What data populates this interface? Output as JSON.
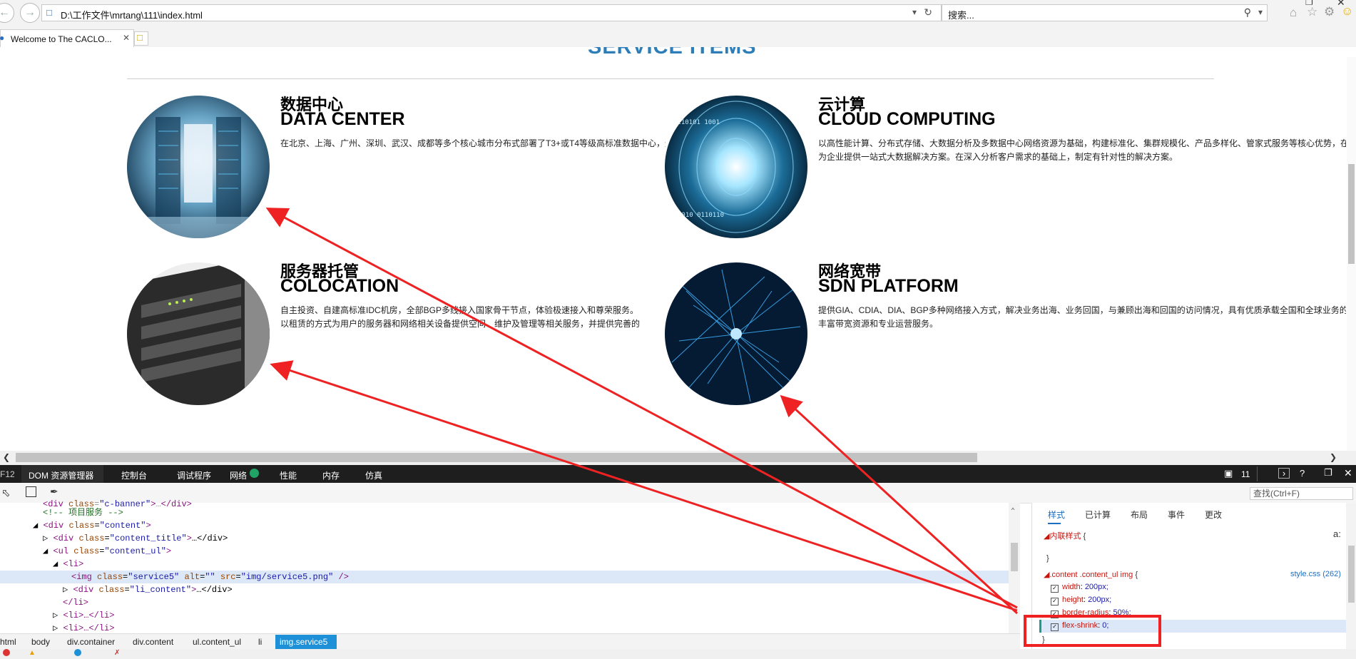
{
  "browser": {
    "url": "D:\\工作文件\\mrtang\\111\\index.html",
    "search_placeholder": "搜索...",
    "tab_title": "Welcome to The CACLO...",
    "back_icon": "back-arrow-icon",
    "forward_icon": "forward-arrow-icon"
  },
  "page": {
    "section_title": "SERVICE ITEMS",
    "services": [
      {
        "title_zh": "数据中心",
        "title_en": "DATA CENTER",
        "desc_lines": [
          "在北京、上海、广州、深圳、武汉、成都等多个核心城市分布式部署了T3+或T4等级高标准数据中心，通过超高带宽、多线路BGP网络接入，满足客户业务需求，提供一站式基础设施服务。"
        ]
      },
      {
        "title_zh": "云计算",
        "title_en": "CLOUD COMPUTING",
        "desc_lines": [
          "以高性能计算、分布式存储、大数据分析及多数据中心网络资源为基础，构建标准化、集群规模化、产品多样化、管家式服务等核心优势，在大数据时代",
          "为企业提供一站式大数据解决方案。在深入分析客户需求的基础上，制定有针对性的解决方案。"
        ]
      },
      {
        "title_zh": "服务器托管",
        "title_en": "COLOCATION",
        "desc_lines": [
          "自主投资、自建高标准IDC机房，全部BGP多线接入国家骨干节点，体验极速接入和尊荣服务。",
          "以租赁的方式为用户的服务器和网络相关设备提供空间、维护及管理等相关服务，并提供完善的"
        ]
      },
      {
        "title_zh": "网络宽带",
        "title_en": "SDN PLATFORM",
        "desc_lines": [
          "提供GIA、CDIA、DIA、BGP多种网络接入方式，解决业务出海、业务回国，与兼顾出海和回国的访问情况，具有优质承载全国和全球业务的",
          "丰富带宽资源和专业运营服务。"
        ]
      }
    ]
  },
  "devtools": {
    "f12": "F12",
    "tabs": [
      "DOM 资源管理器",
      "控制台",
      "调试程序",
      "网络",
      "性能",
      "内存",
      "仿真"
    ],
    "counter": "11",
    "find_placeholder": "查找(Ctrl+F)",
    "dom_lines": [
      {
        "indent": 3,
        "html": "<div class=\"c-banner\">…</div>"
      },
      {
        "indent": 3,
        "comment": "<!-- 项目服务 -->"
      },
      {
        "indent": 3,
        "tag": "div",
        "attr": "class",
        "val": "content"
      },
      {
        "indent": 4,
        "tag": "div",
        "attr": "class",
        "val": "content_title",
        "collapsed": "…</div>"
      },
      {
        "indent": 4,
        "tag": "ul",
        "attr": "class",
        "val": "content_ul"
      },
      {
        "indent": 5,
        "plain": "<li>"
      },
      {
        "indent": 6,
        "img": true
      },
      {
        "indent": 6,
        "tag": "div",
        "attr": "class",
        "val": "li_content",
        "collapsed": "…</div>"
      },
      {
        "indent": 5,
        "plain": "</li>"
      },
      {
        "indent": 5,
        "plain": "<li>…</li>"
      },
      {
        "indent": 5,
        "plain": "<li>…</li>"
      }
    ],
    "img_line": {
      "cls": "service5",
      "alt": "",
      "src": "img/service5.png"
    },
    "breadcrumb": [
      "html",
      "body",
      "div.container",
      "div.content",
      "ul.content_ul",
      "li",
      "img.service5"
    ],
    "styles_tabs": [
      "样式",
      "已计算",
      "布局",
      "事件",
      "更改"
    ],
    "inline_style_label": "内联样式",
    "rule_selector": ".content .content_ul img",
    "rule_source": "style.css (262)",
    "rules": [
      {
        "prop": "width",
        "val": "200px;"
      },
      {
        "prop": "height",
        "val": "200px;"
      },
      {
        "prop": "border-radius",
        "val": "50%;"
      },
      {
        "prop": "flex-shrink",
        "val": "0;"
      }
    ]
  },
  "colors": {
    "accent": "#2d7db8",
    "annotation": "#ee2222",
    "devtools_bar": "#1e1e1e",
    "breadcrumb_active": "#1e90d8"
  }
}
